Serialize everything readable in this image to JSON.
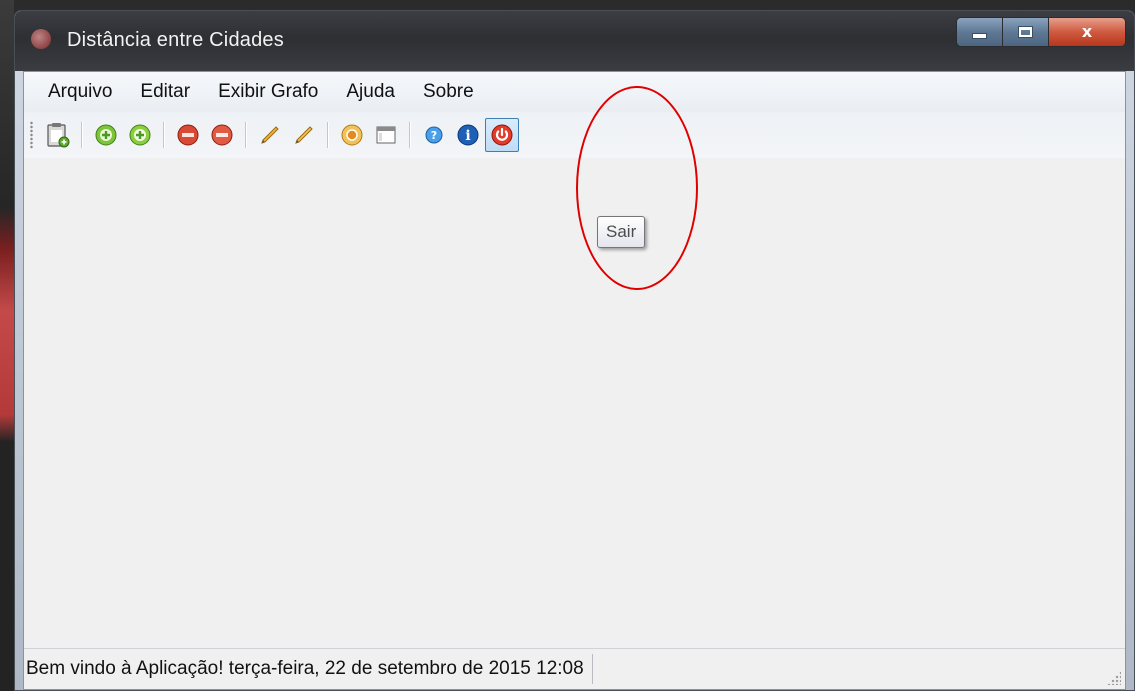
{
  "window": {
    "title": "Distância entre Cidades",
    "controls": {
      "minimize": "minimize",
      "maximize": "maximize",
      "close": "x"
    }
  },
  "menubar": {
    "items": [
      {
        "label": "Arquivo"
      },
      {
        "label": "Editar"
      },
      {
        "label": "Exibir Grafo"
      },
      {
        "label": "Ajuda"
      },
      {
        "label": "Sobre"
      }
    ]
  },
  "toolbar": {
    "buttons": [
      {
        "icon": "clipboard-add-icon"
      },
      {
        "icon": "add-green-icon"
      },
      {
        "icon": "add-green-alt-icon"
      },
      {
        "icon": "remove-red-icon"
      },
      {
        "icon": "remove-red-alt-icon"
      },
      {
        "icon": "pencil-icon"
      },
      {
        "icon": "pencil-alt-icon"
      },
      {
        "icon": "graph-node-icon"
      },
      {
        "icon": "window-icon"
      },
      {
        "icon": "help-blue-icon"
      },
      {
        "icon": "info-blue-icon"
      },
      {
        "icon": "exit-power-icon"
      }
    ]
  },
  "tooltip": {
    "text": "Sair"
  },
  "statusbar": {
    "message": "Bem vindo à Aplicação!  terça-feira, 22 de setembro de 2015  12:08"
  },
  "colors": {
    "annotation": "#e00000",
    "active_border": "#3c7fb1",
    "window_bg": "#f0f0f0"
  }
}
